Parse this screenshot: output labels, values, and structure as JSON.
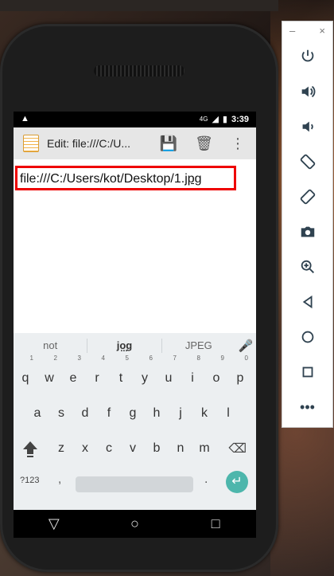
{
  "status": {
    "time": "3:39",
    "network": "4G"
  },
  "app": {
    "title": "Edit: file:///C:/U...",
    "icons": [
      "notepad-icon",
      "save-icon",
      "delete-icon",
      "more-icon"
    ]
  },
  "editor": {
    "text_prefix": "file:///C:/Users/kot/Desktop/1.",
    "text_underlined": "jpg"
  },
  "keyboard": {
    "suggestions": [
      "not",
      "jog",
      "JPEG"
    ],
    "row1": [
      "q",
      "w",
      "e",
      "r",
      "t",
      "y",
      "u",
      "i",
      "o",
      "p"
    ],
    "row1_numbers": [
      "1",
      "2",
      "3",
      "4",
      "5",
      "6",
      "7",
      "8",
      "9",
      "0"
    ],
    "row2": [
      "a",
      "s",
      "d",
      "f",
      "g",
      "h",
      "j",
      "k",
      "l"
    ],
    "row3": [
      "z",
      "x",
      "c",
      "v",
      "b",
      "n",
      "m"
    ],
    "sym_label": "?123",
    "comma": ",",
    "period": "."
  },
  "emulator": {
    "window_controls": [
      "–",
      "×"
    ],
    "buttons": [
      "power",
      "volume-up",
      "volume-down",
      "rotate-left",
      "rotate-right",
      "screenshot",
      "zoom",
      "back",
      "home",
      "overview",
      "more"
    ],
    "more_label": "•••"
  }
}
